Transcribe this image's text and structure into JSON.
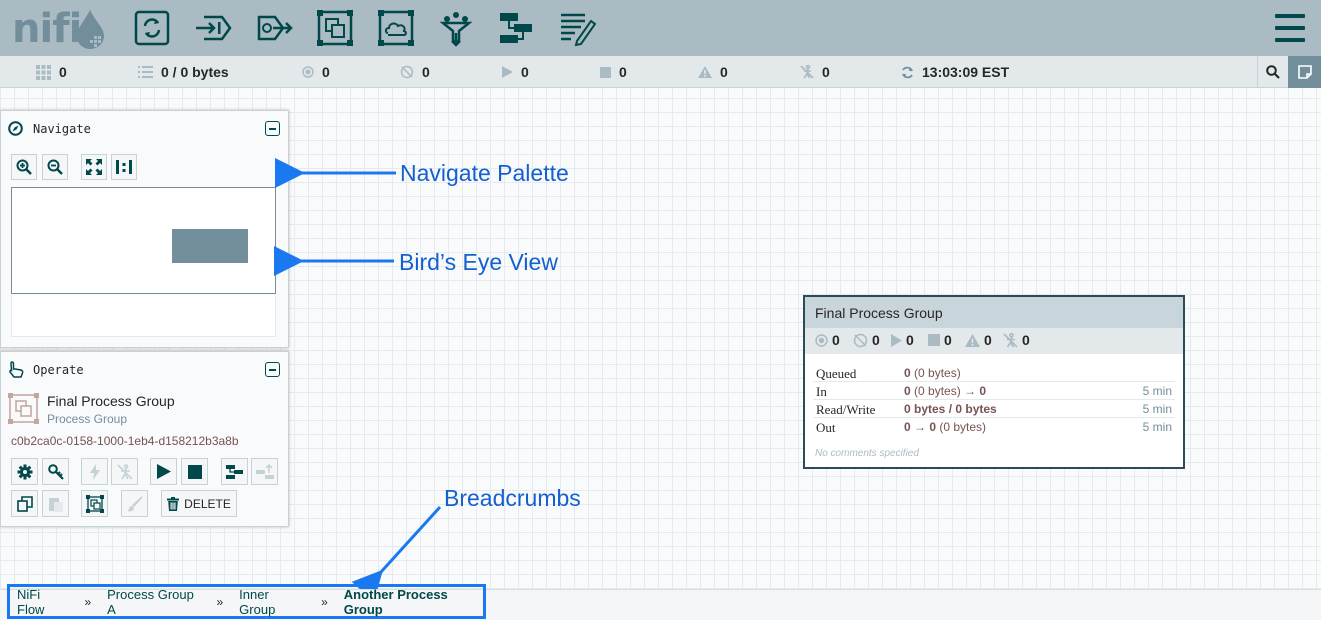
{
  "header": {
    "logo_text": "nifi",
    "toolbar": [
      {
        "name": "processor-tool",
        "icon": "processor-icon"
      },
      {
        "name": "input-port-tool",
        "icon": "input-port-icon"
      },
      {
        "name": "output-port-tool",
        "icon": "output-port-icon"
      },
      {
        "name": "process-group-tool",
        "icon": "process-group-icon"
      },
      {
        "name": "remote-process-group-tool",
        "icon": "remote-process-group-icon"
      },
      {
        "name": "funnel-tool",
        "icon": "funnel-icon"
      },
      {
        "name": "template-tool",
        "icon": "template-icon"
      },
      {
        "name": "label-tool",
        "icon": "label-icon"
      }
    ]
  },
  "status_bar": {
    "active_threads": "0",
    "queued": "0 / 0 bytes",
    "transmitting": "0",
    "not_transmitting": "0",
    "running": "0",
    "stopped": "0",
    "invalid": "0",
    "disabled": "0",
    "last_refreshed": "13:03:09 EST"
  },
  "navigate": {
    "title": "Navigate"
  },
  "operate": {
    "title": "Operate",
    "component_name": "Final Process Group",
    "component_type": "Process Group",
    "component_id": "c0b2ca0c-0158-1000-1eb4-d158212b3a8b",
    "delete_label": "DELETE"
  },
  "annotations": {
    "navigate": "Navigate Palette",
    "birdseye": "Bird’s Eye View",
    "breadcrumbs": "Breadcrumbs"
  },
  "process_group": {
    "title": "Final Process Group",
    "stats": {
      "transmitting": "0",
      "not_transmitting": "0",
      "running": "0",
      "stopped": "0",
      "invalid": "0",
      "disabled": "0"
    },
    "rows": [
      {
        "label": "Queued",
        "value_bold": "0",
        "value_rest": " (0 bytes)",
        "time": ""
      },
      {
        "label": "In",
        "value_bold": "0",
        "value_rest": " (0 bytes) → ",
        "value_bold2": "0",
        "time": "5 min"
      },
      {
        "label": "Read/Write",
        "value_bold": "0 bytes / 0 bytes",
        "value_rest": "",
        "time": "5 min"
      },
      {
        "label": "Out",
        "value_bold": "0 → 0",
        "value_rest": " (0 bytes)",
        "time": "5 min"
      }
    ],
    "comments": "No comments specified"
  },
  "breadcrumbs": {
    "items": [
      "NiFi Flow",
      "Process Group A",
      "Inner Group"
    ],
    "current": "Another Process Group",
    "separator": "»"
  },
  "colors": {
    "header_bg": "#aabbc3",
    "icon_dark": "#004849",
    "accent_grey": "#728e9b",
    "annotation_blue": "#1560d0"
  }
}
